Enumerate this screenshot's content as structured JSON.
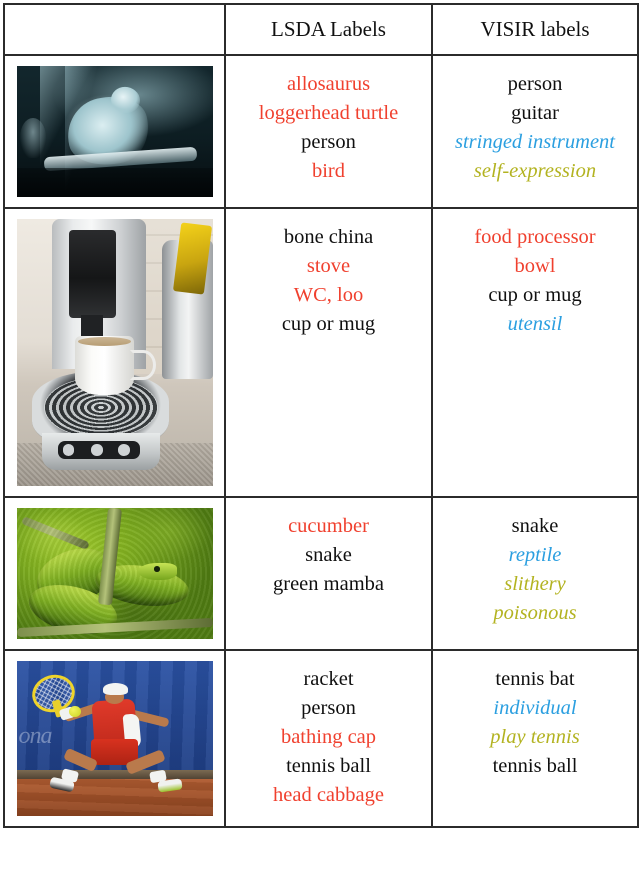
{
  "table": {
    "headers": {
      "image_col": "",
      "lsda": "LSDA Labels",
      "visir": "VISIR labels"
    },
    "colors": {
      "red": "#f0402e",
      "blue": "#2b9fe0",
      "olive": "#b3b321",
      "black": "#101010",
      "border": "#2b2b2b"
    },
    "rows": [
      {
        "image_alt": "guitarist performing on a dark stage under teal light",
        "lsda": [
          {
            "text": "allosaurus",
            "style": "red"
          },
          {
            "text": "loggerhead turtle",
            "style": "red"
          },
          {
            "text": "person",
            "style": "black"
          },
          {
            "text": "bird",
            "style": "red"
          }
        ],
        "visir": [
          {
            "text": "person",
            "style": "black"
          },
          {
            "text": "guitar",
            "style": "black"
          },
          {
            "text": "stringed instrument",
            "style": "blue"
          },
          {
            "text": "self-expression",
            "style": "olive"
          }
        ]
      },
      {
        "image_alt": "white coffee cup on a pod coffee machine in a kitchen",
        "lsda": [
          {
            "text": "bone china",
            "style": "black"
          },
          {
            "text": "stove",
            "style": "red"
          },
          {
            "text": "WC, loo",
            "style": "red"
          },
          {
            "text": "cup or mug",
            "style": "black"
          }
        ],
        "visir": [
          {
            "text": "food processor",
            "style": "red"
          },
          {
            "text": "bowl",
            "style": "red"
          },
          {
            "text": "cup or mug",
            "style": "black"
          },
          {
            "text": "utensil",
            "style": "blue"
          }
        ]
      },
      {
        "image_alt": "green snakes coiled around branches",
        "lsda": [
          {
            "text": "cucumber",
            "style": "red"
          },
          {
            "text": "snake",
            "style": "black"
          },
          {
            "text": "green mamba",
            "style": "black"
          }
        ],
        "visir": [
          {
            "text": "snake",
            "style": "black"
          },
          {
            "text": "reptile",
            "style": "blue"
          },
          {
            "text": "slithery",
            "style": "olive"
          },
          {
            "text": "poisonous",
            "style": "olive"
          }
        ]
      },
      {
        "image_alt": "tennis player in red hitting a forehand on a clay court",
        "lsda": [
          {
            "text": "racket",
            "style": "black"
          },
          {
            "text": "person",
            "style": "black"
          },
          {
            "text": "bathing cap",
            "style": "red"
          },
          {
            "text": "tennis ball",
            "style": "black"
          },
          {
            "text": "head cabbage",
            "style": "red"
          }
        ],
        "visir": [
          {
            "text": "tennis bat",
            "style": "black"
          },
          {
            "text": "individual",
            "style": "blue"
          },
          {
            "text": "play tennis",
            "style": "olive"
          },
          {
            "text": "tennis ball",
            "style": "black"
          }
        ]
      }
    ]
  }
}
